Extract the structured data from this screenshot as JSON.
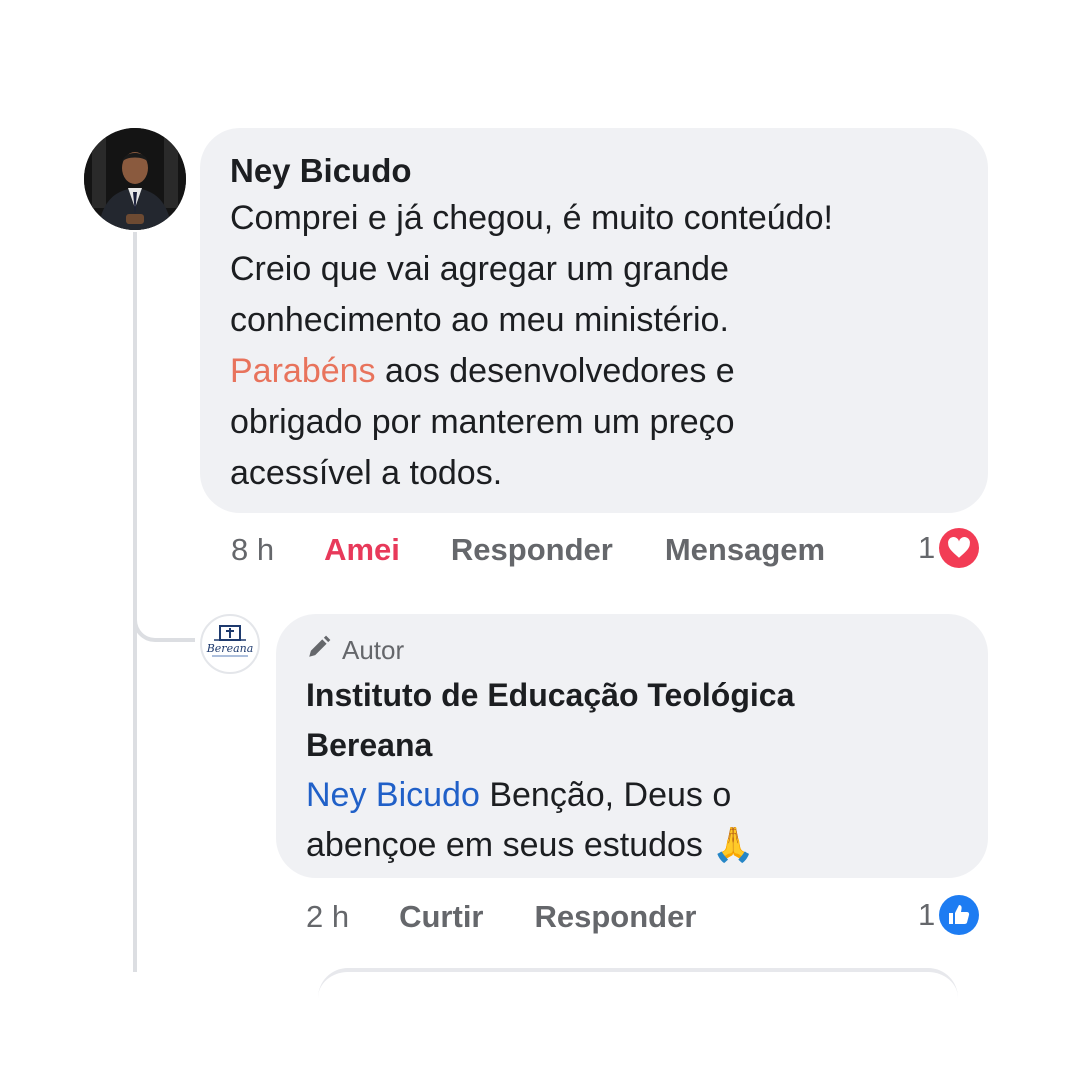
{
  "comment": {
    "author": "Ney Bicudo",
    "text_parts": [
      "Comprei e já chegou, é muito conteúdo!",
      "Creio que vai agregar um grande",
      "conhecimento ao meu ministério.",
      "Parabéns",
      "aos desenvolvedores e",
      "obrigado por manterem um preço",
      "acessível a todos."
    ],
    "time": "8 h",
    "actions": {
      "love": "Amei",
      "reply": "Responder",
      "message": "Mensagem"
    },
    "reaction_count": "1",
    "reaction_icon": "heart-icon",
    "colors": {
      "highlight": "#e8735c",
      "love": "#e8395a"
    }
  },
  "reply": {
    "badge_icon": "pencil-icon",
    "badge": "Autor",
    "author_line1": "Instituto de Educação Teológica",
    "author_line2": "Bereana",
    "mention": "Ney Bicudo",
    "text_line1": " Benção,  Deus o",
    "text_line2": "abençoe em seus estudos ",
    "emoji": "🙏",
    "avatar_text": "Bereana",
    "time": "2 h",
    "actions": {
      "like": "Curtir",
      "reply": "Responder"
    },
    "reaction_count": "1",
    "reaction_icon": "thumbs-up-icon",
    "colors": {
      "mention": "#2060c8",
      "like": "#1d7cf2"
    }
  }
}
